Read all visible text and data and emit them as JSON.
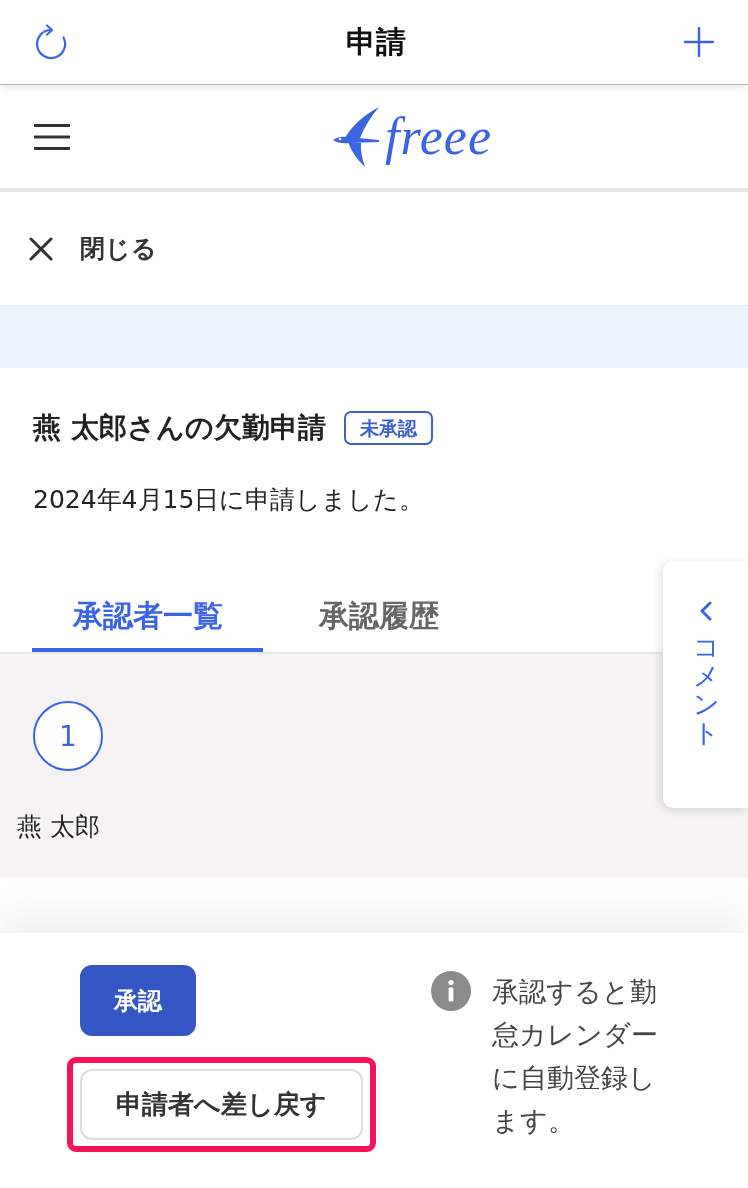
{
  "header": {
    "title": "申請"
  },
  "logo_bar": {
    "logo_text": "freee"
  },
  "close": {
    "label": "閉じる"
  },
  "request": {
    "title": "燕 太郎さんの欠勤申請",
    "status": "未承認",
    "submitted": "2024年4月15日に申請しました。"
  },
  "tabs": [
    {
      "label": "承認者一覧",
      "selected": true
    },
    {
      "label": "承認履歴",
      "selected": false
    }
  ],
  "approvers": [
    {
      "step": "1",
      "name": "燕 太郎"
    }
  ],
  "comment_tab": {
    "label": "コメント"
  },
  "footer": {
    "buttons": [
      {
        "label": "承認",
        "kind": "primary",
        "highlighted": false
      },
      {
        "label": "申請者へ差し戻す",
        "kind": "secondary",
        "highlighted": true
      }
    ],
    "note": "承認すると勤怠カレンダーに自動登録します。"
  }
}
